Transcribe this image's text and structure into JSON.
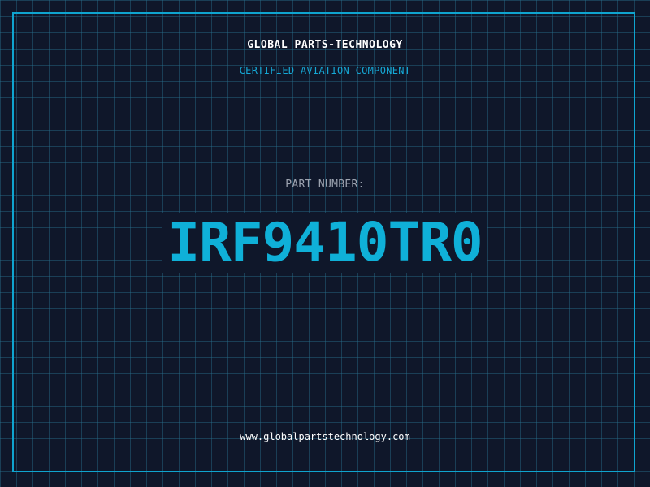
{
  "header": {
    "company": "GLOBAL PARTS-TECHNOLOGY",
    "tagline": "CERTIFIED AVIATION COMPONENT"
  },
  "part": {
    "label": "PART NUMBER:",
    "number": "IRF9410TR0"
  },
  "footer": {
    "website": "www.globalpartstechnology.com"
  },
  "colors": {
    "background": "#0f172a",
    "accent": "#0fb0d8",
    "grid": "#286e8c",
    "text": "#ffffff",
    "muted": "#9ca3b0"
  }
}
